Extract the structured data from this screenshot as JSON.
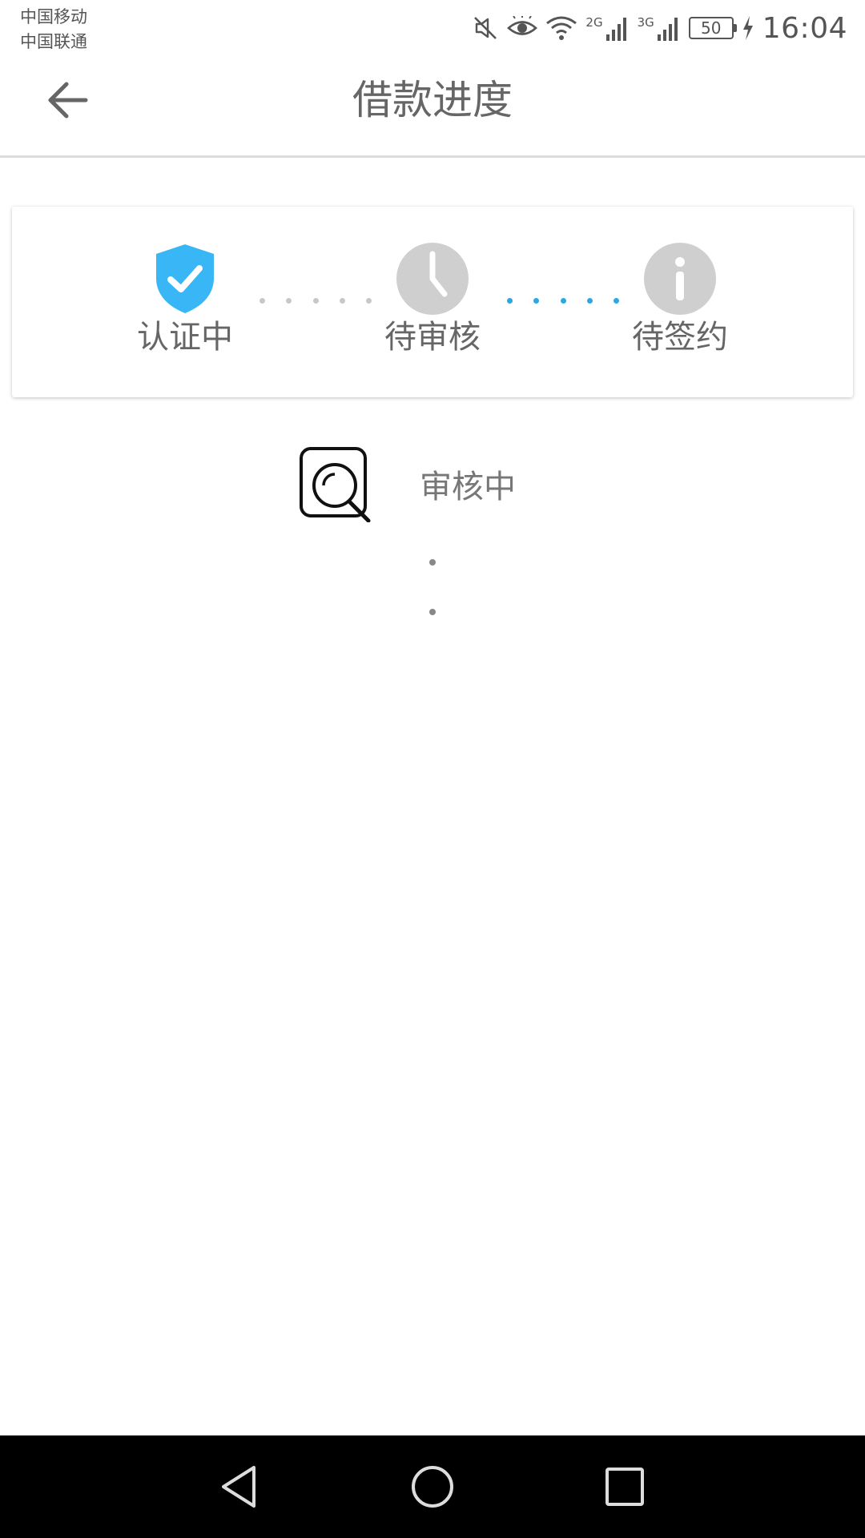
{
  "status_bar": {
    "carrier_1": "中国移动",
    "carrier_2": "中国联通",
    "network_1": "2G",
    "network_2": "3G",
    "battery": "50",
    "time": "16:04",
    "icons": [
      "mute-icon",
      "eye-icon",
      "wifi-icon",
      "signal-icon",
      "signal-icon",
      "battery-icon",
      "charging-icon"
    ]
  },
  "header": {
    "title": "借款进度",
    "back_icon": "arrow-left-icon"
  },
  "progress": {
    "steps": [
      {
        "label": "认证中",
        "icon": "shield-check-icon",
        "state": "done",
        "color": "#38b6f5"
      },
      {
        "label": "待审核",
        "icon": "clock-icon",
        "state": "pending",
        "color": "#cfcfcf"
      },
      {
        "label": "待签约",
        "icon": "info-icon",
        "state": "pending",
        "color": "#cfcfcf"
      }
    ],
    "connector_colors": [
      "#c8c8c8",
      "#2ea7e0"
    ]
  },
  "review": {
    "label": "审核中",
    "icon": "document-search-icon"
  },
  "nav": {
    "icons": [
      "back-triangle-icon",
      "home-circle-icon",
      "recents-square-icon"
    ]
  }
}
